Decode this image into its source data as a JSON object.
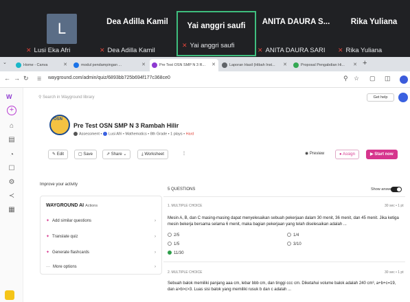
{
  "meeting": {
    "participants": [
      {
        "initial": "L",
        "name": "",
        "sub_name": "Lusi Eka Afri"
      },
      {
        "initial": "",
        "name": "Dea Adilla Kamil",
        "sub_name": "Dea Adilla Kamil"
      },
      {
        "initial": "",
        "name": "Yai anggri saufi",
        "sub_name": "Yai anggri saufi"
      },
      {
        "initial": "",
        "name": "ANITA DAURA S...",
        "sub_name": "ANITA DAURA SARI"
      },
      {
        "initial": "",
        "name": "Rika Yuliana",
        "sub_name": "Rika Yuliana"
      }
    ]
  },
  "browser": {
    "tabs": [
      {
        "label": "Home - Canva"
      },
      {
        "label": "modul pendampingan ..."
      },
      {
        "label": "Pre Test OSN SMP N 3 R..."
      },
      {
        "label": "Laporan Hasil (Hibah Inst..."
      },
      {
        "label": "Proposal Pengabdian Hi..."
      }
    ],
    "url": "wayground.com/admin/quiz/6893bb725b694f177c368ce0"
  },
  "app": {
    "logo": "W",
    "search_placeholder": "Search in Wayground library",
    "get_help": "Get help"
  },
  "quiz": {
    "logo_text": "OSN",
    "title": "Pre Test OSN SMP N 3 Rambah Hilir",
    "meta_type": "Assessment",
    "meta_author": "Lusi Afri",
    "meta_subject": "Mathematics",
    "meta_grade": "8th Grade",
    "meta_plays": "1 plays",
    "meta_difficulty": "Hard",
    "buttons": {
      "edit": "Edit",
      "save": "Save",
      "share": "Share",
      "worksheet": "Worksheet",
      "more": "⋮",
      "preview": "Preview",
      "assign": "Assign",
      "start": "Start now"
    }
  },
  "left_panel": {
    "heading": "Improve your activity",
    "ai_brand": "WAYGROUND AI",
    "ai_actions": "Actions",
    "items": [
      {
        "label": "Add similar questions"
      },
      {
        "label": "Translate quiz"
      },
      {
        "label": "Generate flashcards"
      },
      {
        "label": "More options"
      }
    ]
  },
  "questions": {
    "count_label": "5 QUESTIONS",
    "show_answers_label": "Show answers",
    "show_answers_on": true,
    "items": [
      {
        "type": "1. MULTIPLE CHOICE",
        "time": "30 sec • 1 pt",
        "text": "Mesin A, B, dan C masing-masing dapat menyelesaikan sebuah pekerjaan dalam 30 menit, 36 menit, dan 45 menit. Jika ketiga mesin bekerja bersama selama 6 menit, maka bagian pekerjaan yang telah diselesaikan adalah ...",
        "options": [
          "2/5",
          "1/4",
          "1/5",
          "3/10",
          "11/30"
        ],
        "correct_index": 4
      },
      {
        "type": "2. MULTIPLE CHOICE",
        "time": "30 sec • 1 pt",
        "text": "Sebuah balok memiliki panjang aaa cm, lebar bbb cm, dan tinggi ccc cm. Diketahui volume balok adalah 240 cm³, a+b+c=19, dan a>b>c>3. Luas sisi balok yang memiliki rusuk b dan c adalah ..."
      }
    ]
  },
  "colors": {
    "brand_purple": "#8e3ad1",
    "accent_pink": "#d6358d",
    "correct_green": "#2e9e4a",
    "meet_bg": "#202124",
    "active_speaker": "#3fbf7f"
  }
}
